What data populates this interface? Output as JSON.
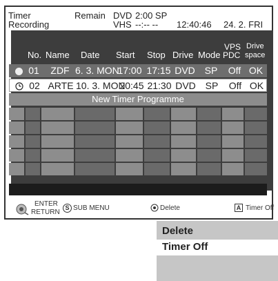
{
  "header": {
    "title_line1": "Timer",
    "title_line2": "Recording",
    "remain_label": "Remain",
    "dvd_label": "DVD",
    "dvd_value": "2:00 SP",
    "vhs_label": "VHS",
    "vhs_value": "--:--  --",
    "clock": "12:40:46",
    "date": "24. 2. FRI"
  },
  "columns": {
    "no": "No.",
    "name": "Name",
    "date": "Date",
    "start": "Start",
    "stop": "Stop",
    "drive": "Drive",
    "mode": "Mode",
    "vps_line1": "VPS",
    "vps_line2": "PDC",
    "space_line1": "Drive",
    "space_line2": "space"
  },
  "rows": [
    {
      "no": "01",
      "name": "ZDF",
      "date": "6. 3. MON",
      "start": "17:00",
      "stop": "17:15",
      "drive": "DVD",
      "mode": "SP",
      "vps": "Off",
      "space": "OK",
      "icon": "record-dot-icon"
    },
    {
      "no": "02",
      "name": "ARTE",
      "date": "10. 3. MON",
      "start": "20:45",
      "stop": "21:30",
      "drive": "DVD",
      "mode": "SP",
      "vps": "Off",
      "space": "OK",
      "icon": "clock-icon"
    }
  ],
  "new_programme": "New Timer Programme",
  "footer": {
    "enter": "ENTER",
    "return": "RETURN",
    "sub_menu_key": "S",
    "sub_menu": "SUB MENU",
    "delete": "Delete",
    "timer_off_key": "A",
    "timer_off": "Timer Off"
  },
  "popup_menu": {
    "items": [
      "Delete",
      "Timer Off"
    ]
  }
}
